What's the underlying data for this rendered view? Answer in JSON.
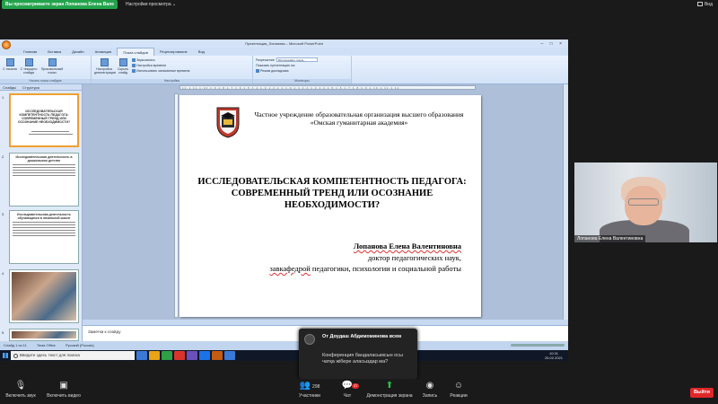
{
  "zoom_top": {
    "share_status": "Вы просматриваете экран Лопанова Елена Вале",
    "view_options": "Настройки просмотра ⌄",
    "view_label": "Вид"
  },
  "powerpoint": {
    "window_title": "Презентация_Лопанова – Microsoft PowerPoint",
    "window_controls": "– □ ×",
    "tabs": [
      "Главная",
      "Вставка",
      "Дизайн",
      "Анимация",
      "Показ слайдов",
      "Рецензирование",
      "Вид"
    ],
    "active_tab": "Показ слайдов",
    "ribbon": {
      "start_group_label": "Начать показ слайдов",
      "from_start": "С начала",
      "from_current": "С текущего слайда",
      "custom_show": "Произвольный показ",
      "setup_group_label": "Настройка",
      "setup_show": "Настройка демонстрации",
      "hide_slide": "Скрыть слайд",
      "record": "Звукозапись",
      "rehearse": "Настройка времени",
      "use_timings": "Использовать записанные времена",
      "monitors_group_label": "Мониторы",
      "resolution_label": "Разрешение:",
      "resolution_value": "Использовать текущ…",
      "show_on_label": "Показать презентацию на:",
      "presenter_view": "Режим докладчика"
    },
    "left_pane_tabs": [
      "Слайды",
      "Структура"
    ],
    "thumbnails": [
      {
        "num": "1",
        "title": "ИССЛЕДОВАТЕЛЬСКАЯ КОМПЕТЕНТНОСТЬ ПЕДАГОГА: СОВРЕМЕННЫЙ ТРЕНД ИЛИ ОСОЗНАНИЕ НЕОБХОДИМОСТИ?"
      },
      {
        "num": "2",
        "title": "Исследовательская деятельность в дошкольном детстве"
      },
      {
        "num": "3",
        "title": "Исследовательская деятельность обучающихся в начальной школе"
      },
      {
        "num": "4",
        "title": ""
      },
      {
        "num": "5",
        "title": ""
      }
    ],
    "slide": {
      "institution": "Частное учреждение образовательная организация высшего образования «Омская гуманитарная академия»",
      "title": "ИССЛЕДОВАТЕЛЬСКАЯ КОМПЕТЕНТНОСТЬ ПЕДАГОГА: СОВРЕМЕННЫЙ ТРЕНД ИЛИ ОСОЗНАНИЕ НЕОБХОДИМОСТИ?",
      "author": "Лопанова Елена Валентиновна",
      "degree": "доктор педагогических наук,",
      "dept_prefix": "завкафедрой",
      "dept_rest": " педагогики, психологии и социальной работы"
    },
    "notes_placeholder": "Заметки к слайду",
    "status": {
      "slide_of": "Слайд 1 из 11",
      "theme": "Тема Office",
      "language": "Русский (Россия)"
    },
    "ruler_text": "·12·1·11·1·10·1·9·1·8·1·7·1·6·1·5·1·4·1·3·1·2·1·1·1·0·1·1·1·2·1·3·1·4·1·5·1·6·1·7·1·8·1·9·1·10·1·11·1·12"
  },
  "taskbar": {
    "search_placeholder": "Введите здесь текст для поиска",
    "time": "10:31",
    "date": "26.02.2021",
    "app_colors": [
      "#3b78d8",
      "#e8a317",
      "#2f9e44",
      "#d9342b",
      "#6b4fbb",
      "#1a73e8",
      "#c55a11",
      "#3b78d8"
    ]
  },
  "participant": {
    "name": "Лопанова Елена Валентиновна"
  },
  "chat_toast": {
    "sender": "От Доудаш Абдимоминова всем",
    "message": "Конференция бандаласымсын осы чатқа жібере аласыздар ма?"
  },
  "zoom_controls": {
    "unmute": "Включить звук",
    "start_video": "Включить видео",
    "participants": "Участники",
    "participants_count": "298",
    "chat": "Чат",
    "chat_badge": "37",
    "share_screen": "Демонстрация экрана",
    "record": "Запись",
    "reactions": "Реакции",
    "leave": "Выйти"
  }
}
